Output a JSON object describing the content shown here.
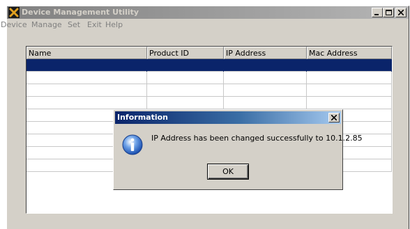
{
  "window": {
    "title": "Device Management Utility",
    "icon": "x-app-icon"
  },
  "menu": {
    "items": [
      "Device",
      "Manage",
      "Set",
      "Exit",
      "Help"
    ]
  },
  "device_list": {
    "columns": [
      "Name",
      "Product ID",
      "IP Address",
      "Mac Address"
    ],
    "rows": [
      {
        "name": "",
        "product_id": "",
        "ip_address": "",
        "mac_address": "",
        "selected": true
      },
      {
        "name": "",
        "product_id": "",
        "ip_address": "",
        "mac_address": ""
      },
      {
        "name": "",
        "product_id": "",
        "ip_address": "",
        "mac_address": ""
      },
      {
        "name": "",
        "product_id": "",
        "ip_address": "",
        "mac_address": ""
      },
      {
        "name": "",
        "product_id": "",
        "ip_address": "",
        "mac_address": ""
      },
      {
        "name": "",
        "product_id": "",
        "ip_address": "",
        "mac_address": ""
      },
      {
        "name": "",
        "product_id": "",
        "ip_address": "",
        "mac_address": ""
      },
      {
        "name": "",
        "product_id": "",
        "ip_address": "",
        "mac_address": ""
      },
      {
        "name": "",
        "product_id": "",
        "ip_address": "",
        "mac_address": ""
      }
    ]
  },
  "dialog": {
    "title": "Information",
    "message": "IP Address has been changed successfully to 10.1.2.85",
    "ok_label": "OK",
    "icon": "info-icon"
  },
  "colors": {
    "selection": "#0a246a",
    "face": "#d4d0c8",
    "inactive_title": "#808080",
    "active_title": "#0a246a"
  }
}
